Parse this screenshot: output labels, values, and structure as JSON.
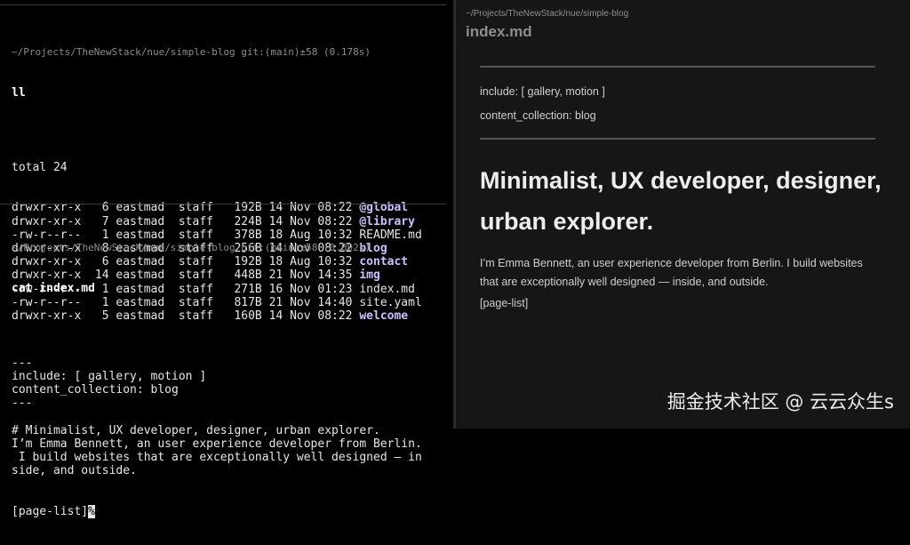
{
  "terminal": {
    "pane1": {
      "prompt": "~/Projects/TheNewStack/nue/simple-blog git:(main)±58 (0.178s)",
      "command": "ll",
      "total": "total 24",
      "rows": [
        {
          "perms": "drwxr-xr-x",
          "links": "6",
          "owner": "eastmad",
          "group": "staff",
          "size": "192B",
          "date": "14 Nov 08:22",
          "name": "@global",
          "is_dir": true
        },
        {
          "perms": "drwxr-xr-x",
          "links": "7",
          "owner": "eastmad",
          "group": "staff",
          "size": "224B",
          "date": "14 Nov 08:22",
          "name": "@library",
          "is_dir": true
        },
        {
          "perms": "-rw-r--r--",
          "links": "1",
          "owner": "eastmad",
          "group": "staff",
          "size": "378B",
          "date": "18 Aug 10:32",
          "name": "README.md",
          "is_dir": false
        },
        {
          "perms": "drwxr-xr-x",
          "links": "8",
          "owner": "eastmad",
          "group": "staff",
          "size": "256B",
          "date": "14 Nov 08:22",
          "name": "blog",
          "is_dir": true
        },
        {
          "perms": "drwxr-xr-x",
          "links": "6",
          "owner": "eastmad",
          "group": "staff",
          "size": "192B",
          "date": "18 Aug 10:32",
          "name": "contact",
          "is_dir": true
        },
        {
          "perms": "drwxr-xr-x",
          "links": "14",
          "owner": "eastmad",
          "group": "staff",
          "size": "448B",
          "date": "21 Nov 14:35",
          "name": "img",
          "is_dir": true
        },
        {
          "perms": "-rw-r--r--",
          "links": "1",
          "owner": "eastmad",
          "group": "staff",
          "size": "271B",
          "date": "16 Nov 01:23",
          "name": "index.md",
          "is_dir": false
        },
        {
          "perms": "-rw-r--r--",
          "links": "1",
          "owner": "eastmad",
          "group": "staff",
          "size": "817B",
          "date": "21 Nov 14:40",
          "name": "site.yaml",
          "is_dir": false
        },
        {
          "perms": "drwxr-xr-x",
          "links": "5",
          "owner": "eastmad",
          "group": "staff",
          "size": "160B",
          "date": "14 Nov 08:22",
          "name": "welcome",
          "is_dir": true
        }
      ]
    },
    "pane2": {
      "prompt": "~/Projects/TheNewStack/nue/simple-blog git:(main)±58 (0.092s)",
      "command": "cat index.md",
      "lines": [
        "---",
        "include: [ gallery, motion ]",
        "content_collection: blog",
        "---",
        "",
        "# Minimalist, UX developer, designer, urban explorer.",
        "I’m Emma Bennett, an user experience developer from Berlin.",
        " I build websites that are exceptionally well designed — in",
        "side, and outside.",
        "",
        "",
        "[page-list]"
      ],
      "cursor_char": "%"
    }
  },
  "preview": {
    "path": "~/Projects/TheNewStack/nue/simple-blog",
    "filename": "index.md",
    "meta_include": "include: [ gallery, motion ]",
    "meta_collection": "content_collection: blog",
    "heading": "Minimalist, UX developer, designer, urban explorer.",
    "paragraph": "I’m Emma Bennett, an user experience developer from Berlin. I build websites that are exceptionally well designed — inside, and outside.",
    "page_list": "[page-list]"
  },
  "watermark": "掘金技术社区 @ 云云众生s"
}
